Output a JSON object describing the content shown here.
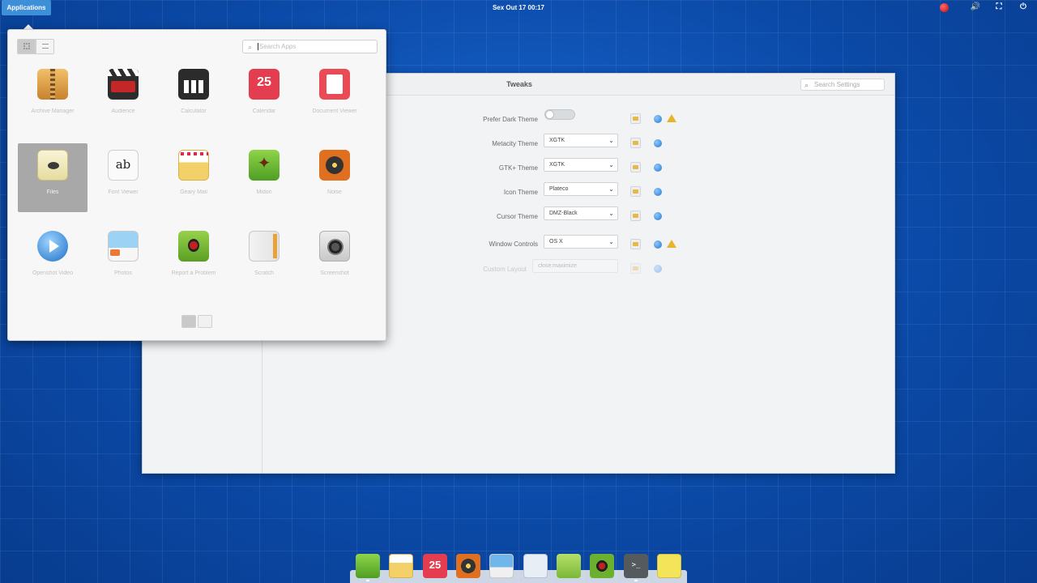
{
  "topbar": {
    "applications_label": "Applications",
    "clock": "Sex Out 17   00:17"
  },
  "tweaks": {
    "title": "Tweaks",
    "search_placeholder": "Search Settings",
    "settings": [
      {
        "label": "Prefer Dark Theme",
        "type": "toggle",
        "value": "off",
        "warn": true
      },
      {
        "label": "Metacity Theme",
        "type": "combo",
        "value": "XGTK",
        "warn": false
      },
      {
        "label": "GTK+ Theme",
        "type": "combo",
        "value": "XGTK",
        "warn": false
      },
      {
        "label": "Icon Theme",
        "type": "combo",
        "value": "Plateco",
        "warn": false
      },
      {
        "label": "Cursor Theme",
        "type": "combo",
        "value": "DMZ-Black",
        "warn": false
      },
      {
        "label": "Window Controls",
        "type": "combo",
        "value": "OS X",
        "warn": true
      },
      {
        "label": "Custom Layout",
        "type": "combo",
        "value": "close:maximize",
        "warn": false,
        "disabled": true
      }
    ]
  },
  "appmenu": {
    "search_placeholder": "Search Apps",
    "apps": [
      {
        "label": "Archive Manager",
        "icon": "archive-manager-icon"
      },
      {
        "label": "Audience",
        "icon": "audience-icon"
      },
      {
        "label": "Calculator",
        "icon": "calculator-icon"
      },
      {
        "label": "Calendar",
        "icon": "calendar-icon",
        "badge": "25"
      },
      {
        "label": "Document Viewer",
        "icon": "document-viewer-icon"
      },
      {
        "label": "Files",
        "icon": "files-icon",
        "selected": true
      },
      {
        "label": "Font Viewer",
        "icon": "font-viewer-icon",
        "glyph": "ab"
      },
      {
        "label": "Geary Mail",
        "icon": "geary-mail-icon"
      },
      {
        "label": "Midori",
        "icon": "midori-icon"
      },
      {
        "label": "Noise",
        "icon": "noise-icon"
      },
      {
        "label": "Openshot Video",
        "icon": "video-player-icon"
      },
      {
        "label": "Photos",
        "icon": "photos-icon"
      },
      {
        "label": "Report a Problem",
        "icon": "report-problem-icon"
      },
      {
        "label": "Scratch",
        "icon": "scratch-icon"
      },
      {
        "label": "Screenshot",
        "icon": "screenshot-icon"
      }
    ],
    "pages": [
      "1",
      "2"
    ]
  },
  "dock": {
    "items": [
      {
        "name": "dock-midori",
        "icon": "midori-icon",
        "color": "#5aaa2a"
      },
      {
        "name": "dock-mail",
        "icon": "mail-icon",
        "color": "#f2d36a"
      },
      {
        "name": "dock-calendar",
        "icon": "calendar-icon",
        "color": "#e43d4f",
        "badge": "25"
      },
      {
        "name": "dock-noise",
        "icon": "music-icon",
        "color": "#e07020"
      },
      {
        "name": "dock-photos",
        "icon": "photos-icon",
        "color": "#6fb7ea"
      },
      {
        "name": "dock-settings",
        "icon": "switchboard-icon",
        "color": "#e8eef5"
      },
      {
        "name": "dock-app-store",
        "icon": "store-icon",
        "color": "#8fc94a"
      },
      {
        "name": "dock-report",
        "icon": "bug-icon",
        "color": "#6bb02e"
      },
      {
        "name": "dock-terminal",
        "icon": "terminal-icon",
        "color": "#555a5f"
      },
      {
        "name": "dock-notes",
        "icon": "notes-icon",
        "color": "#f3e45a"
      }
    ]
  },
  "colors": {
    "accent": "#3d8fd8",
    "desktop": "#0a4fb0",
    "warning": "#e8b42a",
    "calendar": "#e43d4f"
  }
}
